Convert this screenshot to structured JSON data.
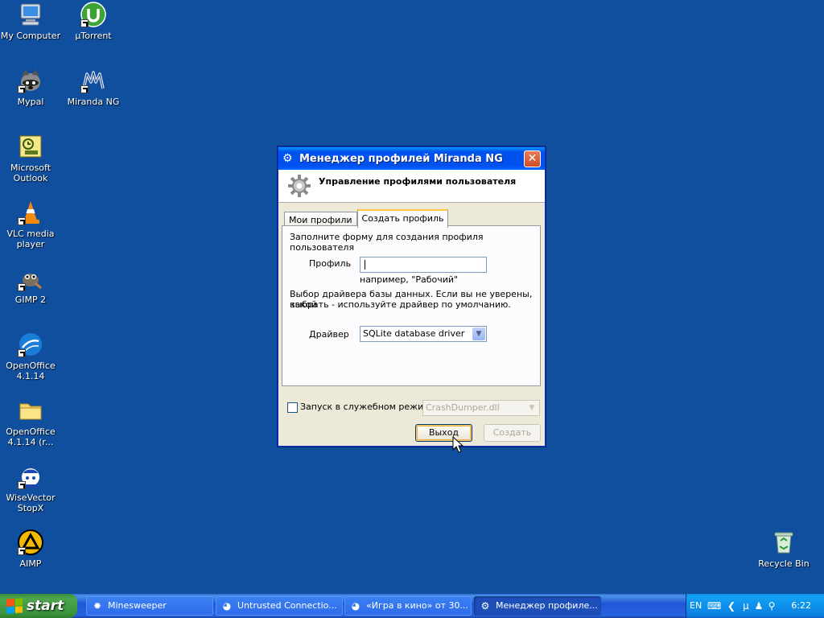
{
  "desktop": {
    "icons": [
      {
        "label": "My Computer"
      },
      {
        "label": "µTorrent"
      },
      {
        "label": "Mypal"
      },
      {
        "label": "Miranda NG"
      },
      {
        "label": "Microsoft Outlook"
      },
      {
        "label": "VLC media player"
      },
      {
        "label": "GIMP 2"
      },
      {
        "label": "OpenOffice 4.1.14"
      },
      {
        "label": "OpenOffice 4.1.14 (r..."
      },
      {
        "label": "WiseVector StopX"
      },
      {
        "label": "AIMP"
      },
      {
        "label": "Recycle Bin"
      }
    ]
  },
  "dialog": {
    "title": "Менеджер профилей Miranda NG",
    "header": "Управление профилями пользователя",
    "tabs": [
      {
        "label": "Мои профили",
        "active": false
      },
      {
        "label": "Создать профиль",
        "active": true
      }
    ],
    "form": {
      "intro": "Заполните форму для создания профиля пользователя",
      "profile_label": "Профиль",
      "profile_value": "",
      "profile_hint": "например, \"Рабочий\"",
      "driver_note_1": "Выбор драйвера базы данных. Если вы не уверены, какой",
      "driver_note_2": "выбрать - используйте драйвер по умолчанию.",
      "driver_label": "Драйвер",
      "driver_value": "SQLite database driver"
    },
    "service_mode_label": "Запуск в служебном режиме",
    "service_mode_checked": false,
    "service_dll": "CrashDumper.dll",
    "exit_button": "Выход",
    "create_button": "Создать"
  },
  "taskbar": {
    "start_label": "start",
    "tasks": [
      {
        "label": "Minesweeper",
        "icon": "minesweeper-icon"
      },
      {
        "label": "Untrusted Connectio...",
        "icon": "mypal-icon"
      },
      {
        "label": "«Игра в кино» от 30...",
        "icon": "mypal-icon"
      },
      {
        "label": "Менеджер профиле...",
        "icon": "gear-icon"
      }
    ],
    "language": "EN",
    "clock": "6:22"
  }
}
